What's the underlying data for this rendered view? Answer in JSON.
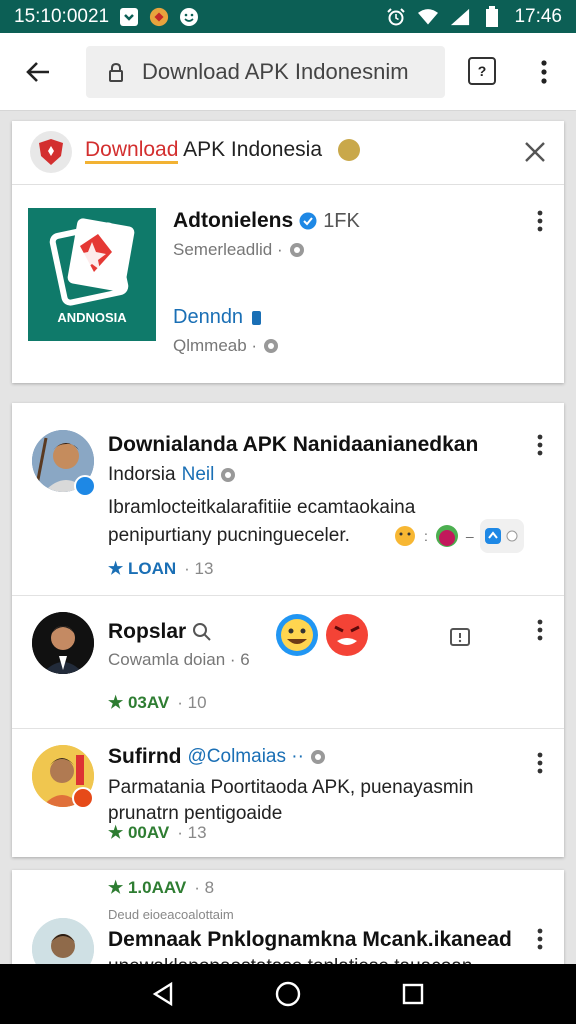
{
  "status_bar": {
    "time_left": "15:10:0021",
    "time_right": "17:46",
    "icons": [
      "download-icon",
      "app-notification-icon",
      "smiley-icon",
      "alarm-icon",
      "wifi-icon",
      "signal-icon",
      "battery-icon"
    ]
  },
  "browser": {
    "url": "Download APK Indonesnim",
    "tab_count": "?"
  },
  "site_card": {
    "title_highlight": "Download",
    "title_rest": " APK Indonesia",
    "app_name": "Adtonielens",
    "app_count": "1FK",
    "app_meta": "Semerleadlid ·",
    "icon_label": "ANDNOSIA",
    "download_link": "Denndn",
    "download_meta": "Qlmmeab ·"
  },
  "posts": [
    {
      "name": "Downialanda APK Nanidaanianedkan",
      "sub": "Indorsia",
      "sub_tag": "Neil",
      "text1": "Ibramlocteitkalarafitiie ecamtaokaina",
      "text2": "penipurtiany pucningueceler.",
      "rating": "★ LOAN",
      "count": "· 13"
    },
    {
      "name": "Ropslar",
      "meta": "Cowamla doian · 6",
      "rating": "★ 03AV",
      "count": "· 10"
    },
    {
      "name": "Sufirnd",
      "handle": "@Colmaias ··",
      "text1": "Parmatania Poortitaoda APK, puenayasmin",
      "text2": "prunatrn pentigoaide",
      "rating": "★ 00AV",
      "count": "· 13"
    },
    {
      "rating": "★ 1.0AAV",
      "count": "· 8",
      "small": "Deud eioeacoalottaim",
      "name": "Demnaak Pnklognamkna Mcank.ikanead",
      "text1": "unewaklapopaostatase tonlatiese tauacoan"
    }
  ],
  "colors": {
    "status_bar": "#0c5f55",
    "accent_red": "#d32f2f",
    "link_blue": "#1a6fb5",
    "rating_green": "#2e7d32",
    "app_icon_teal": "#0f7a6a"
  }
}
